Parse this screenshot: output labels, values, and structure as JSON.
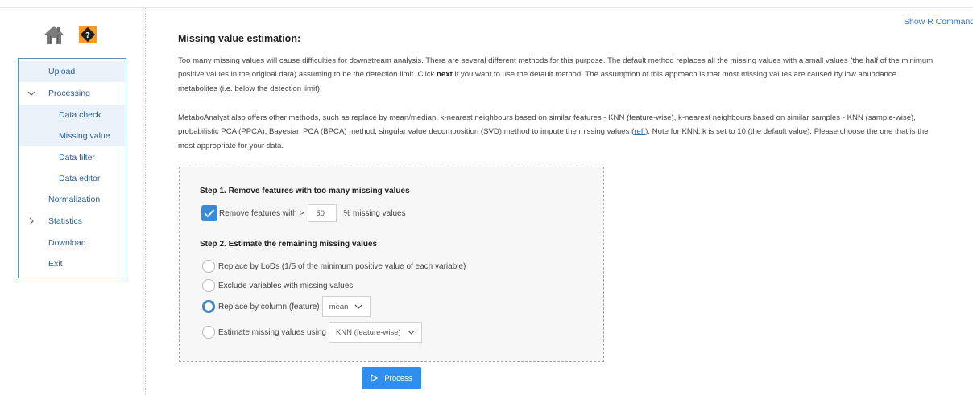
{
  "sidebar": {
    "items": [
      {
        "label": "Upload"
      },
      {
        "label": "Processing"
      },
      {
        "label": "Data check"
      },
      {
        "label": "Missing value"
      },
      {
        "label": "Data filter"
      },
      {
        "label": "Data editor"
      },
      {
        "label": "Normalization"
      },
      {
        "label": "Statistics"
      },
      {
        "label": "Download"
      },
      {
        "label": "Exit"
      }
    ]
  },
  "header": {
    "show_r_commands": "Show R Commands"
  },
  "main": {
    "title": "Missing value estimation:",
    "para1": {
      "a": "Too many missing values will cause difficulties for downstream analysis. There are several different methods for this purpose. The default method replaces all the missing values with a small values (the half of the minimum positive values in the original data) assuming to be the detection limit. Click ",
      "bold": "next",
      "b": " if you want to use the default method. The assumption of this approach is that most missing values are caused by low abundance metabolites (i.e. below the detection limit)."
    },
    "para2": {
      "a": "MetaboAnalyst also offers other methods, such as replace by mean/median, k-nearest neighbours based on similar features - KNN (feature-wise), k-nearest neighbours based on similar samples - KNN (sample-wise), probabilistic PCA (PPCA), Bayesian PCA (BPCA) method, singular value decomposition (SVD) method to impute the missing values (",
      "link": "ref.",
      "b": "). Note for KNN, k is set to 10 (the default value). Please choose the one that is the most appropriate for your data."
    },
    "step1": {
      "title": "Step 1. Remove features with too many missing values",
      "prefix": "Remove features with >",
      "value": "50",
      "suffix": "% missing values",
      "checked": true
    },
    "step2": {
      "title": "Step 2. Estimate the remaining missing values",
      "options": [
        {
          "label": "Replace by LoDs (1/5 of the minimum positive value of each variable)"
        },
        {
          "label": "Exclude variables with missing values"
        },
        {
          "label": "Replace by column (feature)",
          "select_value": "mean"
        },
        {
          "label": "Estimate missing values using",
          "select_value": "KNN (feature-wise)"
        }
      ],
      "selected_index": 2
    },
    "process_label": "Process"
  },
  "colors": {
    "accent": "#2e8ff0",
    "nav_text": "#2d5f93",
    "nav_active_bg": "#ebf2fa",
    "link": "#3278c8"
  }
}
